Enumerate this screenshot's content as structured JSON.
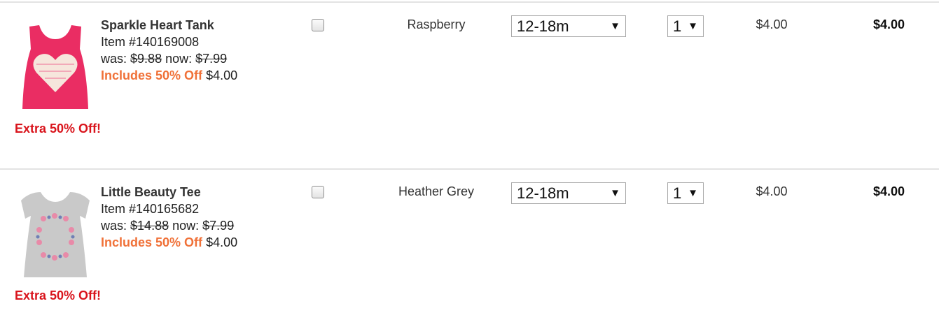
{
  "items": [
    {
      "name": "Sparkle Heart Tank",
      "item_number": "Item #140169008",
      "was_label": "was:",
      "was_price": "$9.88",
      "now_label": "now:",
      "now_price": "$7.99",
      "promo_label": "Includes 50% Off",
      "promo_price": "$4.00",
      "extra_badge": "Extra 50% Off!",
      "color": "Raspberry",
      "size": "12-18m",
      "quantity": "1",
      "unit_price": "$4.00",
      "line_total": "$4.00",
      "image_icon": "pink-heart-tank-top-image"
    },
    {
      "name": "Little Beauty Tee",
      "item_number": "Item #140165682",
      "was_label": "was:",
      "was_price": "$14.88",
      "now_label": "now:",
      "now_price": "$7.99",
      "promo_label": "Includes 50% Off",
      "promo_price": "$4.00",
      "extra_badge": "Extra 50% Off!",
      "color": "Heather Grey",
      "size": "12-18m",
      "quantity": "1",
      "unit_price": "$4.00",
      "line_total": "$4.00",
      "image_icon": "grey-floral-tee-image"
    }
  ],
  "dropdown_arrow": "▼",
  "colors": {
    "promo": "#f07138",
    "extra_badge": "#d9141c",
    "tank_pink": "#ea2d63",
    "tee_grey": "#c9c9c9"
  }
}
